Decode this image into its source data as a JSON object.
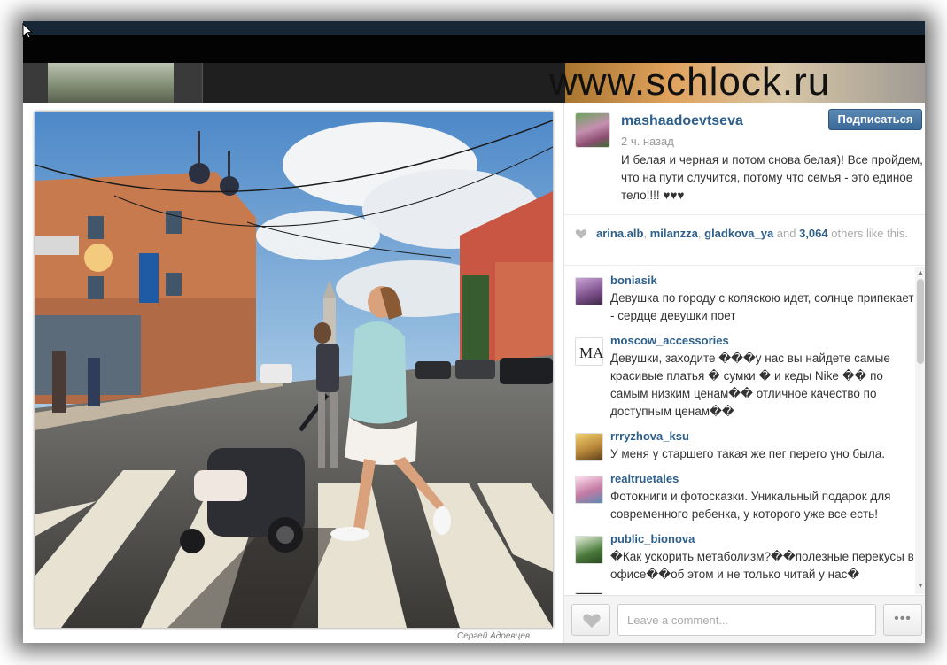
{
  "background": {
    "watermark": "www.schlock.ru"
  },
  "post": {
    "username": "mashaadoevtseva",
    "time_ago": "2 ч. назад",
    "caption": "И белая и черная и потом снова белая)! Все пройдем, что на пути случится, потому что семья - это единое тело!!!! ♥♥♥",
    "follow_label": "Подписаться",
    "photo_credit": "Сергей Адоевцев",
    "photo_icon": "street-crosswalk-photo"
  },
  "likes": {
    "users": [
      "arina.alb",
      "milanzza",
      "gladkova_ya"
    ],
    "sep1": ", ",
    "sep2": ", ",
    "and_word": " and ",
    "count": "3,064",
    "suffix": " others like this."
  },
  "comments": [
    {
      "user": "boniasik",
      "text": "Девушка по городу с коляскою идет, солнце припекает - сердце девушки поет",
      "avatar_color": "#7b4f8a"
    },
    {
      "user": "moscow_accessories",
      "text": "Девушки, заходите ���у нас вы найдете самые красивые платья � сумки � и кеды Nike �� по самым низким ценам�� отличное качество по доступным ценам��",
      "avatar_color": "#ffffff"
    },
    {
      "user": "rrryzhova_ksu",
      "text": "У меня у старшего такая же пег перего уно была.",
      "avatar_color": "#b8873a"
    },
    {
      "user": "realtruetales",
      "text": "Фотокниги и фотосказки. Уникальный подарок для современного ребенка, у которого уже все есть!",
      "avatar_color": "#c47aa3"
    },
    {
      "user": "public_bionova",
      "text": "�Как ускорить метаболизм?��полезные перекусы в офисе��об этом и не только читай у нас�",
      "avatar_color": "#4a7a3b"
    }
  ],
  "composer": {
    "placeholder": "Leave a comment...",
    "more_label": "•••"
  },
  "colors": {
    "link": "#2d5f8a",
    "follow_button": "#3a6a99"
  },
  "icons": {
    "like": "heart-icon",
    "more": "ellipsis-icon",
    "cursor": "mouse-pointer-icon"
  }
}
